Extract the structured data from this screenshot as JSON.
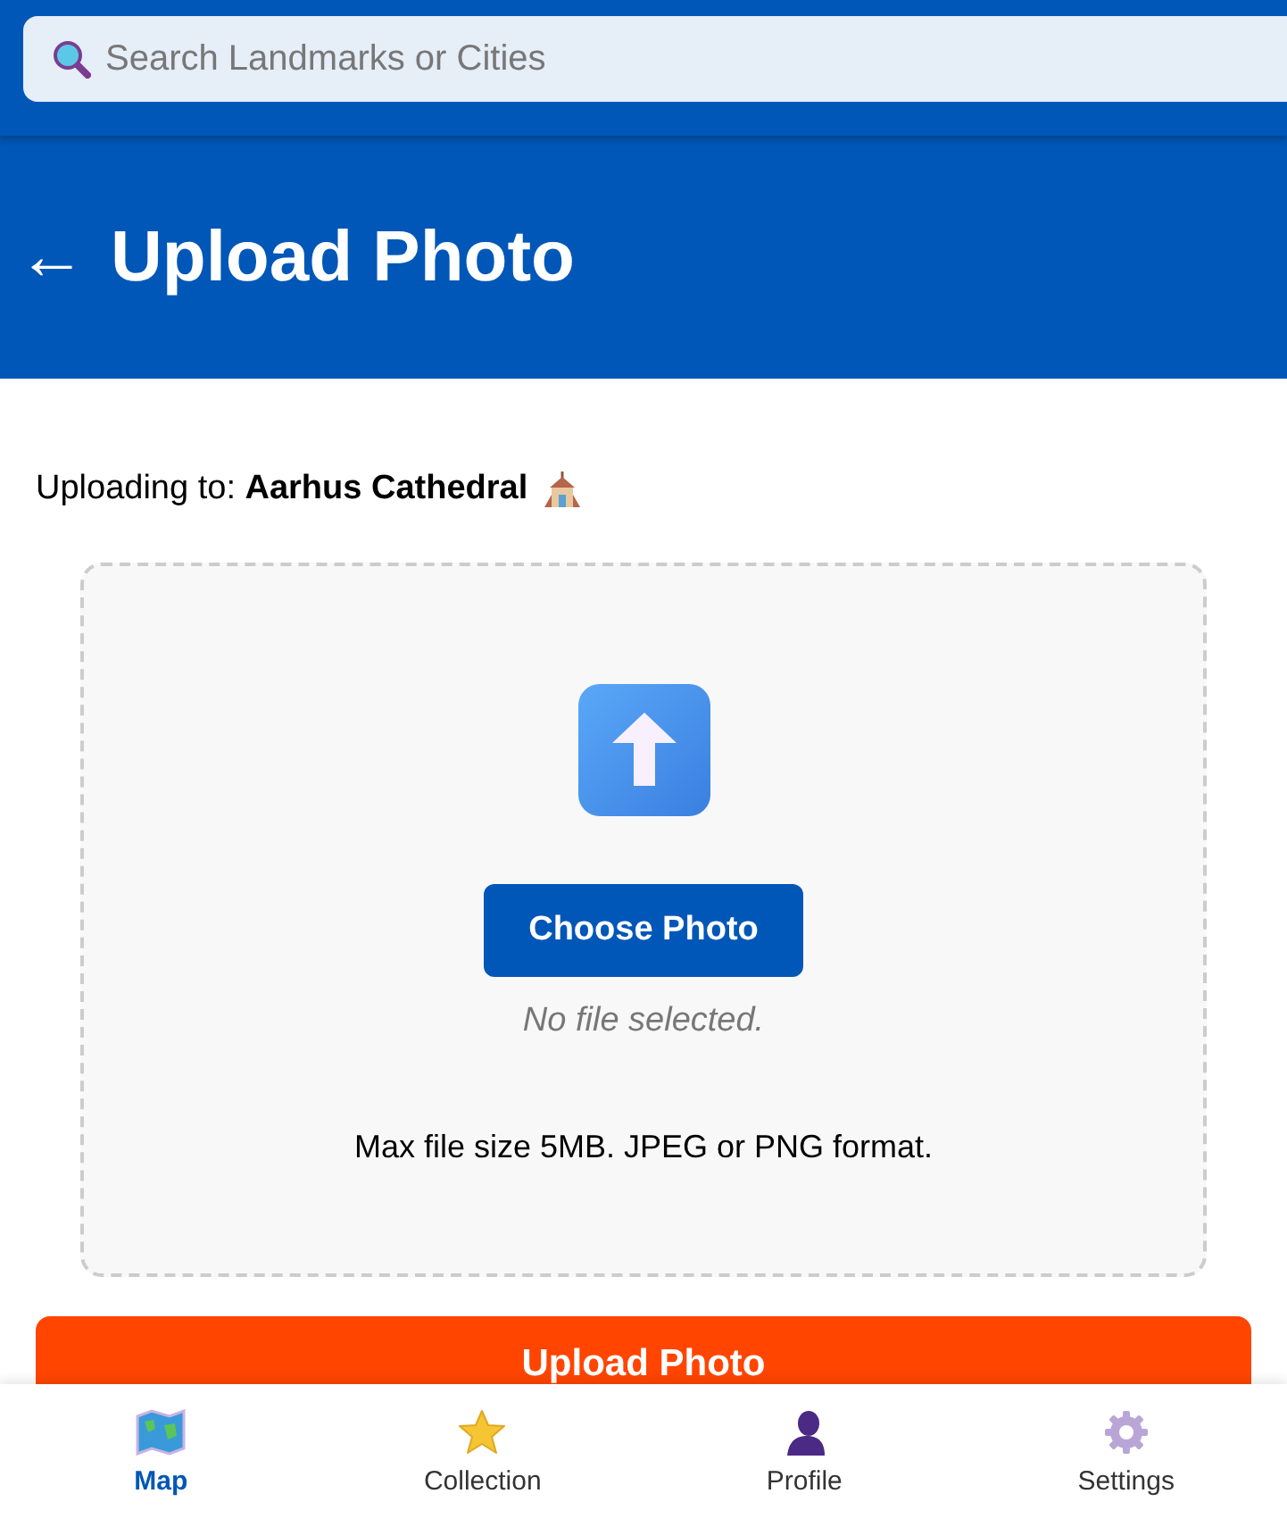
{
  "search": {
    "placeholder": "Search Landmarks or Cities"
  },
  "header": {
    "back": "←",
    "title": "Upload Photo"
  },
  "target": {
    "label": "Uploading to:",
    "name": "Aarhus Cathedral"
  },
  "dropzone": {
    "button": "Choose Photo",
    "status": "No file selected.",
    "hint": "Max file size 5MB. JPEG or PNG format."
  },
  "submit": "Upload Photo",
  "nav": [
    {
      "kind": "map",
      "label": "Map",
      "selected": true
    },
    {
      "kind": "collection",
      "label": "Collection",
      "selected": false
    },
    {
      "kind": "profile",
      "label": "Profile",
      "selected": false
    },
    {
      "kind": "settings",
      "label": "Settings",
      "selected": false
    }
  ]
}
